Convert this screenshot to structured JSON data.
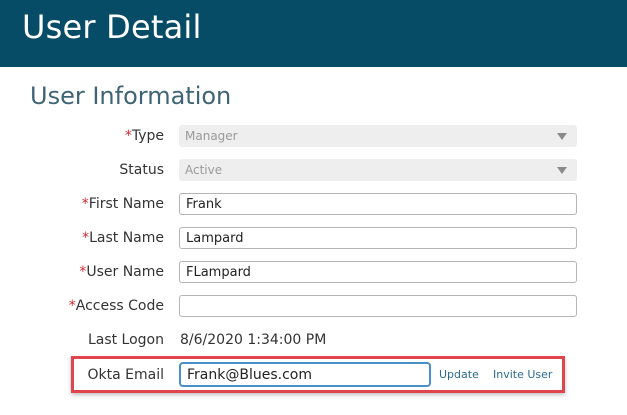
{
  "header": {
    "title": "User Detail"
  },
  "section": {
    "title": "User Information"
  },
  "form": {
    "required_marker": "*",
    "type": {
      "label": "Type",
      "value": "Manager"
    },
    "status": {
      "label": "Status",
      "value": "Active"
    },
    "first_name": {
      "label": "First Name",
      "value": "Frank"
    },
    "last_name": {
      "label": "Last Name",
      "value": "Lampard"
    },
    "user_name": {
      "label": "User Name",
      "value": "FLampard"
    },
    "access_code": {
      "label": "Access Code",
      "value": ""
    },
    "last_logon": {
      "label": "Last Logon",
      "value": "8/6/2020 1:34:00 PM"
    },
    "okta_email": {
      "label": "Okta Email",
      "value": "Frank@Blues.com"
    }
  },
  "actions": {
    "update_label": "Update",
    "invite_label": "Invite User"
  },
  "colors": {
    "header_bg": "#064c66",
    "required": "#d9272e",
    "highlight": "#e0444d",
    "link": "#2a6a8f",
    "focus_border": "#4a90c8"
  }
}
